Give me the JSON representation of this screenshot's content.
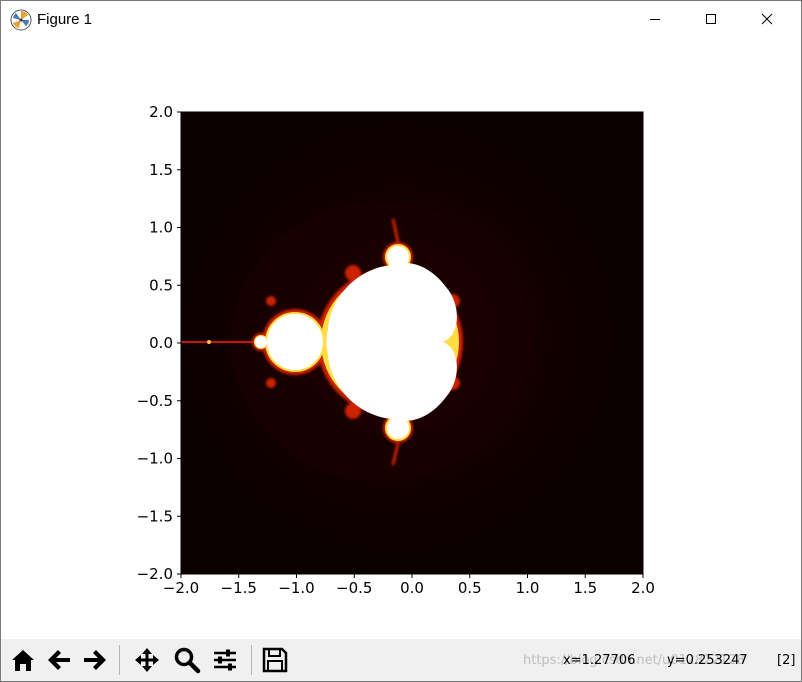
{
  "window": {
    "title": "Figure 1"
  },
  "plot": {
    "x_ticks": [
      "−2.0",
      "−1.5",
      "−1.0",
      "−0.5",
      "0.0",
      "0.5",
      "1.0",
      "1.5",
      "2.0"
    ],
    "y_ticks": [
      "2.0",
      "1.5",
      "1.0",
      "0.5",
      "0.0",
      "−0.5",
      "−1.0",
      "−1.5",
      "−2.0"
    ],
    "xlim": [
      -2.0,
      2.0
    ],
    "ylim": [
      -2.0,
      2.0
    ],
    "colormap": "hot",
    "background_color": "#0a0000",
    "set_color": "#ffffff"
  },
  "toolbar": {
    "buttons": [
      {
        "name": "home-button",
        "icon": "home-icon"
      },
      {
        "name": "back-button",
        "icon": "back-arrow-icon"
      },
      {
        "name": "forward-button",
        "icon": "forward-arrow-icon"
      },
      {
        "name": "pan-button",
        "icon": "move-icon"
      },
      {
        "name": "zoom-button",
        "icon": "magnifier-icon"
      },
      {
        "name": "subplots-button",
        "icon": "sliders-icon"
      },
      {
        "name": "save-button",
        "icon": "floppy-icon"
      }
    ],
    "coord_x": "x=1.27706",
    "coord_y": "y=0.253247",
    "value": "[2]",
    "watermark": "https://blog.csdn.net/u012822128"
  }
}
